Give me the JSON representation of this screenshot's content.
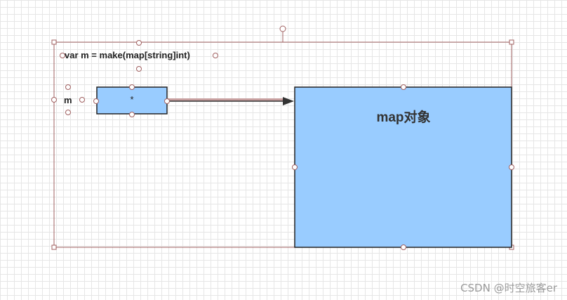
{
  "diagram": {
    "code_text": "var m = make(map[string]int)",
    "variable_name": "m",
    "pointer_symbol": "*",
    "map_object_label": "map对象"
  },
  "watermark": "CSDN @时空旅客er",
  "colors": {
    "box_fill": "#99ccff",
    "box_stroke": "#222222",
    "selection_stroke": "#a06060",
    "arrow": "#333333"
  }
}
